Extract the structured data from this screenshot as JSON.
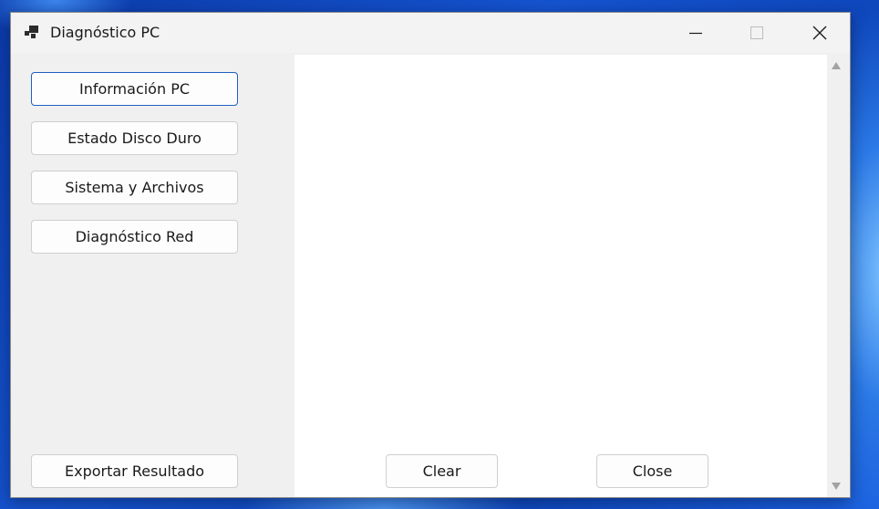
{
  "window": {
    "title": "Diagnóstico PC"
  },
  "sidebar": {
    "items": [
      {
        "label": "Información PC",
        "focused": true
      },
      {
        "label": "Estado Disco Duro"
      },
      {
        "label": "Sistema y Archivos"
      },
      {
        "label": "Diagnóstico Red"
      }
    ],
    "export_label": "Exportar Resultado"
  },
  "output": {
    "text": ""
  },
  "actions": {
    "clear_label": "Clear",
    "close_label": "Close"
  },
  "colors": {
    "window_bg": "#f0f0f0",
    "output_bg": "#ffffff",
    "focus_border": "#1f5fbf"
  }
}
